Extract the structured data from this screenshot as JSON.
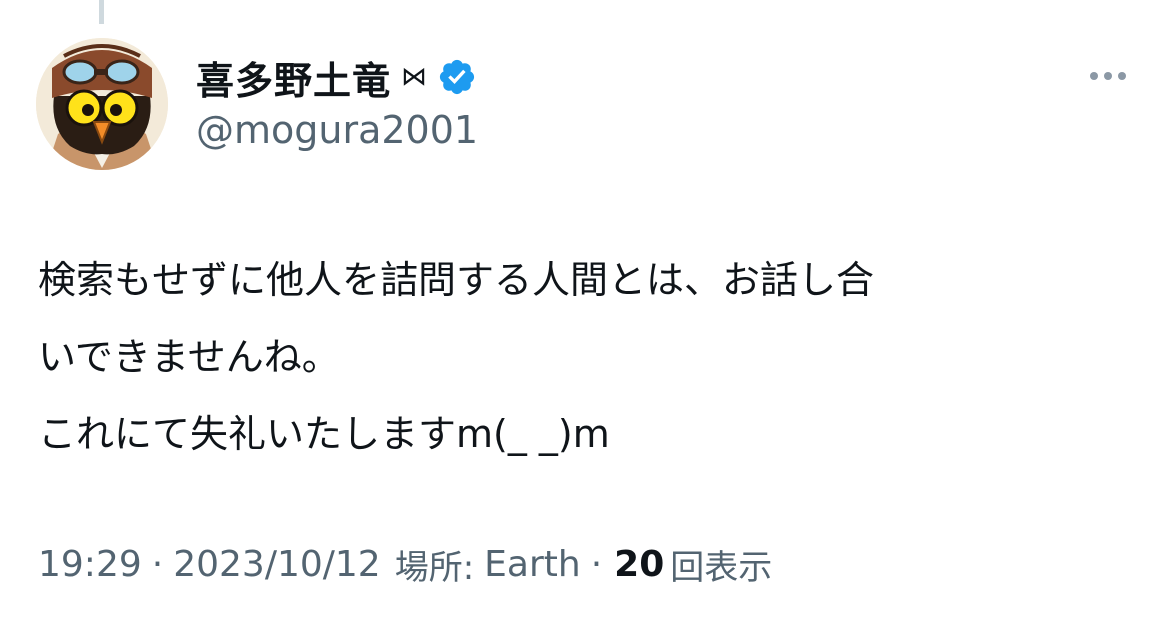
{
  "author": {
    "display_name": "喜多野土竜",
    "name_symbol": "⋈",
    "verified": true,
    "handle": "@mogura2001"
  },
  "tweet": {
    "lines": [
      "検索もせずに他人を詰問する人間とは、お話し合",
      "いできませんね。",
      "これにて失礼いたしますm(_ _)m"
    ]
  },
  "meta": {
    "time": "19:29",
    "separator": "·",
    "date": "2023/10/12",
    "location_label": "場所:",
    "location_value": "Earth",
    "views_count": "20",
    "views_label": "回表示"
  },
  "icons": {
    "more": "more-horizontal-icon",
    "verified": "verified-badge-icon",
    "avatar": "owl-aviator-avatar"
  },
  "colors": {
    "text_primary": "#0f1419",
    "text_secondary": "#536471",
    "verified_blue": "#1d9bf0",
    "thread_line": "#cfd9de"
  }
}
